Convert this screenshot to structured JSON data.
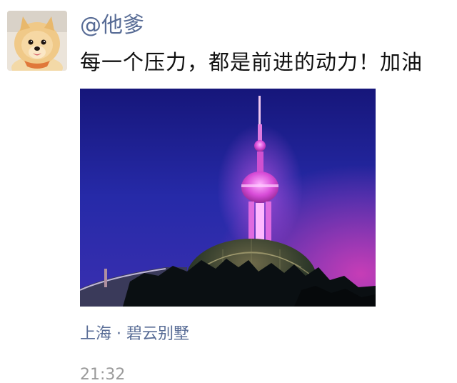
{
  "post": {
    "username": "@他爹",
    "content": "每一个压力，都是前进的动力！加油",
    "location": "上海 · 碧云别墅",
    "time": "21:32"
  },
  "images": {
    "avatar": "pomeranian-dog-avatar",
    "photo": "oriental-pearl-tower-night-photo"
  },
  "colors": {
    "link": "#576b95",
    "text": "#111111",
    "meta": "#9a9a9a"
  }
}
